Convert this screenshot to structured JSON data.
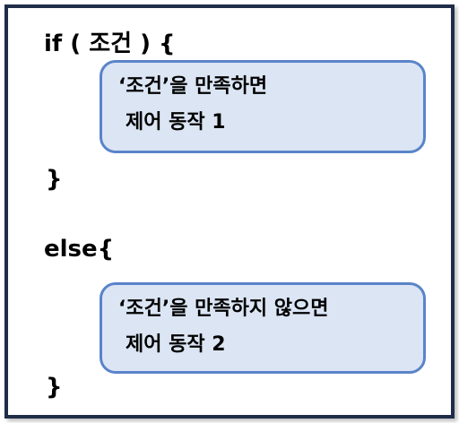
{
  "colors": {
    "frame_border": "#1f2d48",
    "box_fill": "#dbe5f4",
    "box_border": "#5a84c9",
    "text": "#000000"
  },
  "if_block": {
    "header": "if ( 조건 ) {",
    "box_line1": "‘조건’을 만족하면",
    "box_line2": "제어 동작 1",
    "closing": "}"
  },
  "else_block": {
    "header": "else{",
    "box_line1": "‘조건’을 만족하지 않으면",
    "box_line2": "제어 동작 2",
    "closing": "}"
  }
}
